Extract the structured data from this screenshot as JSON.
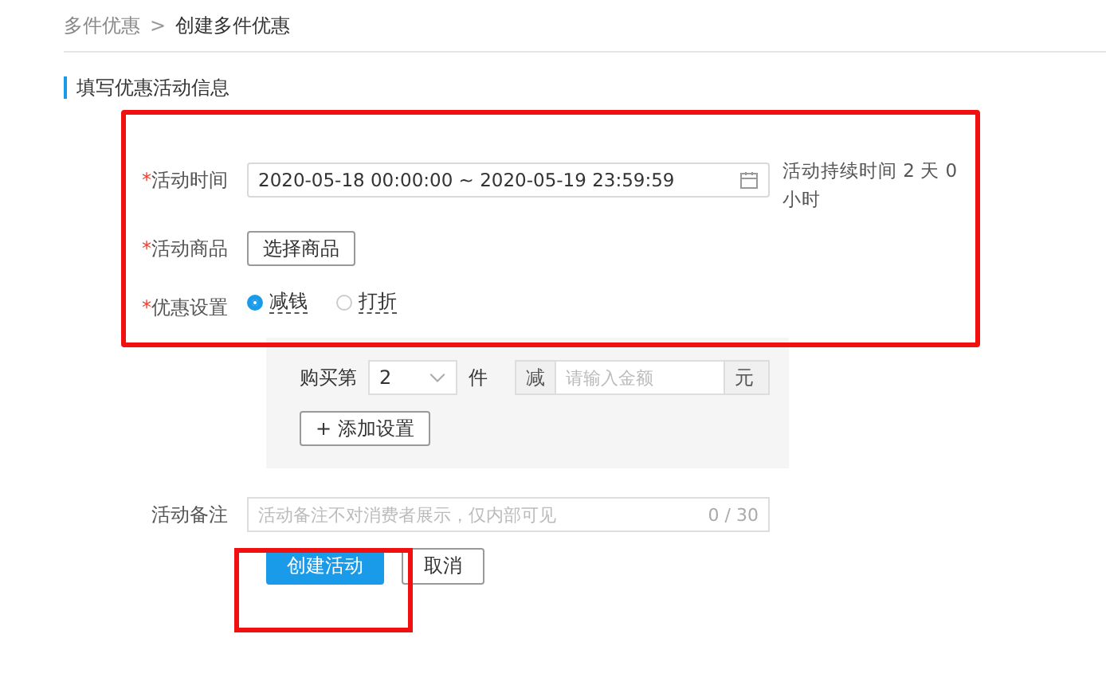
{
  "breadcrumb": {
    "parent": "多件优惠",
    "separator": ">",
    "current": "创建多件优惠"
  },
  "section_title": "填写优惠活动信息",
  "form": {
    "time": {
      "mark": "*",
      "label": "活动时间",
      "value": "2020-05-18 00:00:00 ~ 2020-05-19 23:59:59",
      "note": "活动持续时间 2 天 0 小时"
    },
    "goods": {
      "mark": "*",
      "label": "活动商品",
      "button": "选择商品"
    },
    "discount": {
      "mark": "*",
      "label": "优惠设置",
      "options": [
        {
          "label": "减钱",
          "selected": true
        },
        {
          "label": "打折",
          "selected": false
        }
      ]
    },
    "rule": {
      "prefix": "购买第",
      "count": "2",
      "unit": "件",
      "minus": "减",
      "amount_placeholder": "请输入金额",
      "currency": "元",
      "add_button": "+ 添加设置"
    },
    "remark": {
      "label": "活动备注",
      "placeholder": "活动备注不对消费者展示，仅内部可见",
      "counter": "0 / 30"
    }
  },
  "actions": [
    {
      "label": "创建活动",
      "kind": "primary"
    },
    {
      "label": "取消",
      "kind": "default"
    }
  ]
}
